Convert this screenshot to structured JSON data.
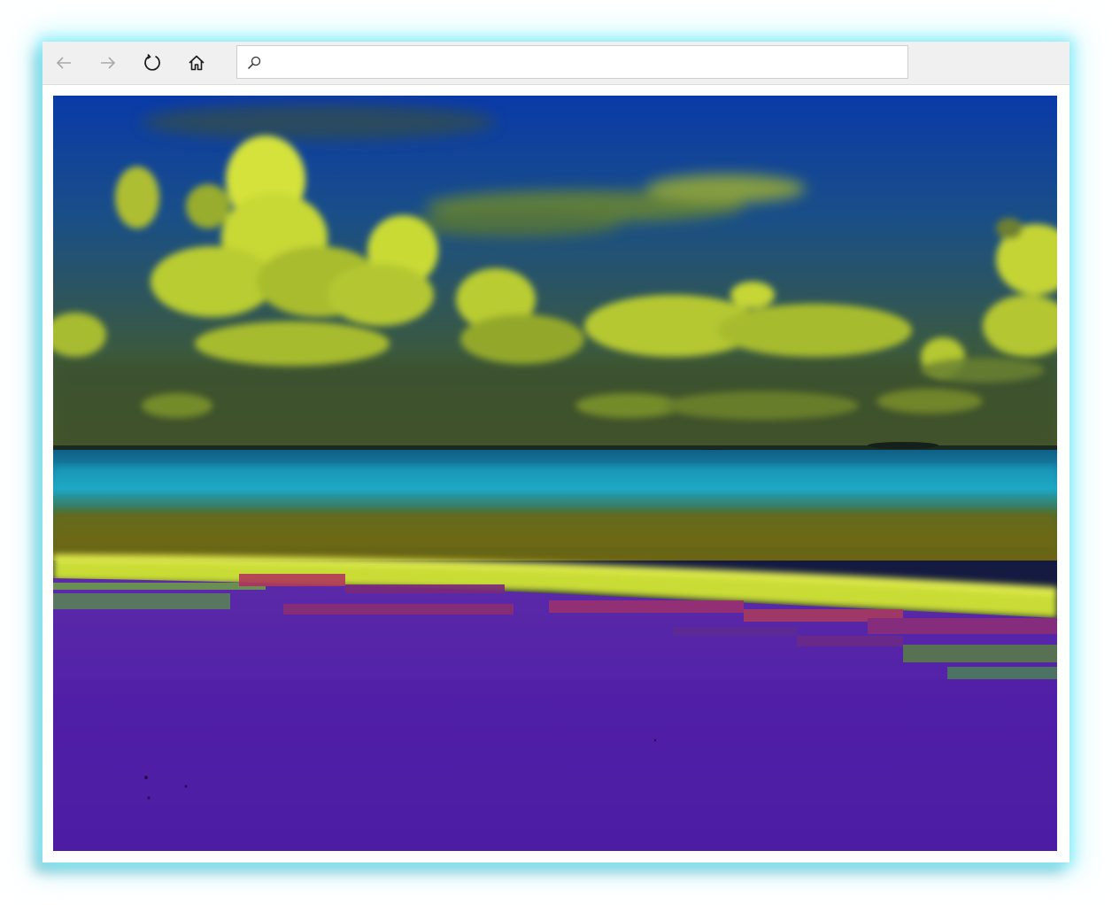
{
  "toolbar": {
    "back_icon": "arrow-left-icon",
    "forward_icon": "arrow-right-icon",
    "reload_icon": "reload-icon",
    "home_icon": "home-icon"
  },
  "address_bar": {
    "icon": "search-icon",
    "value": "",
    "placeholder": ""
  },
  "content": {
    "image_alt": "",
    "colors": {
      "sky_top": "#0a35a8",
      "sky_mid": "#1d4b78",
      "cloud_bright": "#d8e83a",
      "cloud_dark": "#7a8f2a",
      "sea_cyan": "#1aa6c4",
      "sea_olive": "#6b6410",
      "surf": "#d9e43a",
      "sand": "#5a1ea8",
      "sand_dark": "#3e1c8c"
    }
  }
}
